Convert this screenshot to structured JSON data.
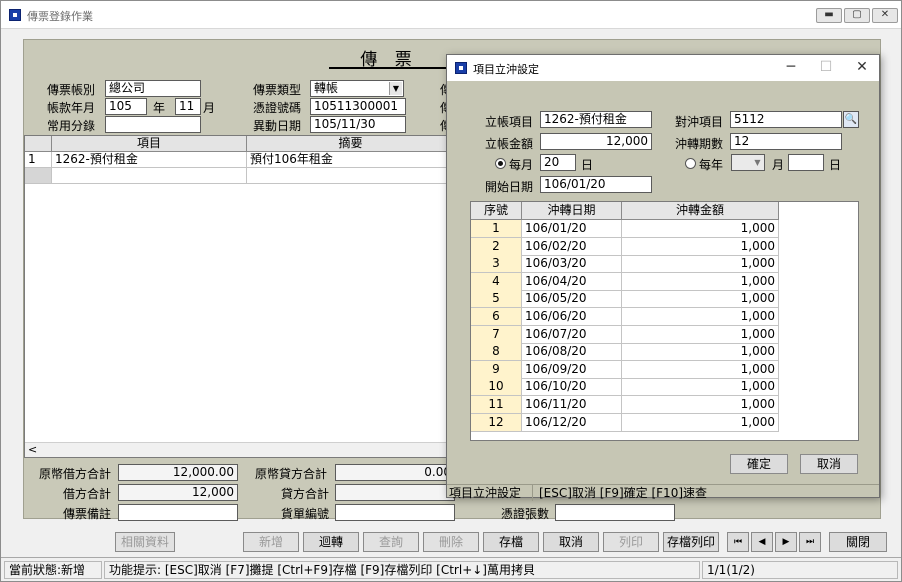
{
  "main": {
    "window_title": "傳票登錄作業",
    "form_title": "傳 票",
    "fields": {
      "account_label": "傳票帳別",
      "account_value": "總公司",
      "period_label": "帳款年月",
      "year_value": "105",
      "year_unit": "年",
      "month_value": "11",
      "month_unit": "月",
      "common_label": "常用分錄",
      "common_value": "",
      "type_label": "傳票類型",
      "type_value": "轉帳",
      "voucher_no_label": "憑證號碼",
      "voucher_no_value": "10511300001",
      "change_date_label": "異動日期",
      "change_date_value": "105/11/30",
      "hidden_label_1": "傳",
      "hidden_label_2": "傳",
      "hidden_label_3": "傳"
    },
    "grid": {
      "headers": [
        "項目",
        "摘要"
      ],
      "rows": [
        {
          "no": "1",
          "item": "1262-預付租金",
          "memo": "預付106年租金"
        }
      ]
    },
    "scroll_left_icon": "<",
    "totals": {
      "orig_debit_label": "原幣借方合計",
      "orig_debit_value": "12,000.00",
      "orig_credit_label": "原幣貸方合計",
      "orig_credit_value": "0.00",
      "debit_label": "借方合計",
      "debit_value": "12,000",
      "credit_label": "貸方合計",
      "credit_value": "",
      "memo_label": "傳票備註",
      "memo_value": "",
      "order_label": "貨單編號",
      "order_value": "",
      "count_label": "憑證張數",
      "count_value": ""
    },
    "toolbar": {
      "related": "相關資料",
      "add": "新增",
      "transfer": "迴轉",
      "query": "查詢",
      "delete": "刪除",
      "save": "存檔",
      "cancel": "取消",
      "print": "列印",
      "save_print": "存檔列印",
      "close": "關閉",
      "nav_first": "⏮",
      "nav_prev": "◀",
      "nav_next": "▶",
      "nav_last": "⏭"
    },
    "status": {
      "state": "當前狀態:新增",
      "hint": "功能提示: [ESC]取消 [F7]攤提 [Ctrl+F9]存檔 [F9]存檔列印 [Ctrl+↓]萬用拷貝",
      "page": "1/1(1/2)"
    }
  },
  "dialog": {
    "title": "項目立沖設定",
    "fields": {
      "item_label": "立帳項目",
      "item_value": "1262-預付租金",
      "offset_label": "對沖項目",
      "offset_value": "5112",
      "amount_label": "立帳金額",
      "amount_value": "12,000",
      "periods_label": "沖轉期數",
      "periods_value": "12",
      "monthly_label": "每月",
      "monthly_day": "20",
      "day_unit": "日",
      "yearly_label": "每年",
      "yearly_month": "",
      "month_unit": "月",
      "yearly_day": "",
      "day_unit_2": "日",
      "start_label": "開始日期",
      "start_value": "106/01/20"
    },
    "grid": {
      "headers": [
        "序號",
        "沖轉日期",
        "沖轉金額"
      ],
      "rows": [
        {
          "no": "1",
          "date": "106/01/20",
          "amount": "1,000"
        },
        {
          "no": "2",
          "date": "106/02/20",
          "amount": "1,000"
        },
        {
          "no": "3",
          "date": "106/03/20",
          "amount": "1,000"
        },
        {
          "no": "4",
          "date": "106/04/20",
          "amount": "1,000"
        },
        {
          "no": "5",
          "date": "106/05/20",
          "amount": "1,000"
        },
        {
          "no": "6",
          "date": "106/06/20",
          "amount": "1,000"
        },
        {
          "no": "7",
          "date": "106/07/20",
          "amount": "1,000"
        },
        {
          "no": "8",
          "date": "106/08/20",
          "amount": "1,000"
        },
        {
          "no": "9",
          "date": "106/09/20",
          "amount": "1,000"
        },
        {
          "no": "10",
          "date": "106/10/20",
          "amount": "1,000"
        },
        {
          "no": "11",
          "date": "106/11/20",
          "amount": "1,000"
        },
        {
          "no": "12",
          "date": "106/12/20",
          "amount": "1,000"
        }
      ]
    },
    "buttons": {
      "ok": "確定",
      "cancel": "取消"
    },
    "status": {
      "name": "項目立沖設定",
      "hint": "[ESC]取消 [F9]確定 [F10]速查"
    }
  },
  "colors": {
    "form_bg": "#c9c9b8",
    "dialog_bg": "#c6c6b4",
    "row_highlight": "#fff3cc",
    "accent_icon": "#1a3fa8"
  }
}
